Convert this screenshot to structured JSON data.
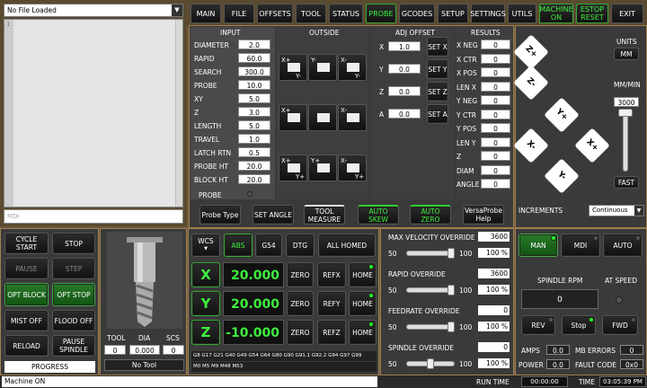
{
  "file": {
    "name": "No File Loaded",
    "line": "1",
    "mdi_placeholder": "MDI"
  },
  "tabs": [
    "MAIN",
    "FILE",
    "OFFSETS",
    "TOOL",
    "STATUS",
    "PROBE",
    "GCODES",
    "SETUP",
    "SETTINGS",
    "UTILS",
    "MACHINE ON",
    "ESTOP RESET",
    "EXIT"
  ],
  "probe": {
    "input_title": "INPUT",
    "outside_title": "OUTSIDE",
    "adj_title": "ADJ OFFSET",
    "results_title": "RESULTS",
    "inputs": [
      {
        "label": "DIAMETER",
        "value": "2.0"
      },
      {
        "label": "RAPID",
        "value": "60.0"
      },
      {
        "label": "SEARCH",
        "value": "300.0"
      },
      {
        "label": "PROBE",
        "value": "10.0"
      },
      {
        "label": "XY",
        "value": "5.0"
      },
      {
        "label": "Z",
        "value": "3.0"
      },
      {
        "label": "LENGTH",
        "value": "5.0"
      },
      {
        "label": "TRAVEL",
        "value": "1.0"
      },
      {
        "label": "LATCH RTN",
        "value": "0.5"
      },
      {
        "label": "PROBE HT",
        "value": "20.0"
      },
      {
        "label": "BLOCK HT",
        "value": "20.0"
      }
    ],
    "probe_label": "PROBE",
    "adj": [
      {
        "label": "X",
        "value": "1.0",
        "btn": "SET X"
      },
      {
        "label": "Y",
        "value": "0.0",
        "btn": "SET Y"
      },
      {
        "label": "Z",
        "value": "0.0",
        "btn": "SET Z"
      },
      {
        "label": "A",
        "value": "0.0",
        "btn": "SET A"
      }
    ],
    "results": [
      {
        "label": "X NEG",
        "value": "0"
      },
      {
        "label": "X CTR",
        "value": "0"
      },
      {
        "label": "X POS",
        "value": "0"
      },
      {
        "label": "LEN X",
        "value": "0"
      },
      {
        "label": "Y NEG",
        "value": "0"
      },
      {
        "label": "Y CTR",
        "value": "0"
      },
      {
        "label": "Y POS",
        "value": "0"
      },
      {
        "label": "LEN Y",
        "value": "0"
      },
      {
        "label": "Z",
        "value": "0"
      },
      {
        "label": "DIAM",
        "value": "0"
      },
      {
        "label": "ANGLE",
        "value": "0"
      }
    ],
    "buttons": [
      "Probe Type",
      "SET ANGLE",
      "TOOL MEASURE",
      "AUTO SKEW",
      "AUTO ZERO",
      "VersaProbe Help"
    ],
    "outside_labels": {
      "xp": "X+",
      "xm": "X-",
      "yp": "Y+",
      "ym": "Y-"
    }
  },
  "jog": {
    "z_plus": "Z+",
    "z_minus": "Z-",
    "y_plus": "Y+",
    "y_minus": "Y-",
    "x_plus": "X+",
    "x_minus": "X-",
    "units_label": "UNITS",
    "units": "MM",
    "rate_label": "MM/MIN",
    "rate": "3000",
    "fast": "FAST",
    "increments_label": "INCREMENTS",
    "increments": "Continuous"
  },
  "left": {
    "cycle_start": "CYCLE START",
    "stop": "STOP",
    "pause": "PAUSE",
    "step": "STEP",
    "opt_block": "OPT BLOCK",
    "opt_stop": "OPT STOP",
    "mist": "MIST OFF",
    "flood": "FLOOD OFF",
    "reload": "RELOAD",
    "pause_spindle": "PAUSE SPINDLE",
    "progress": "PROGRESS"
  },
  "tool": {
    "tool_label": "TOOL",
    "dia_label": "DIA",
    "scs_label": "SCS",
    "tool": "0",
    "dia": "0.000",
    "scs": "0",
    "name": "No Tool"
  },
  "dro": {
    "wcs": "WCS",
    "abs": "ABS",
    "g54": "G54",
    "dtg": "DTG",
    "homed": "ALL HOMED",
    "axes": [
      {
        "axis": "X",
        "value": "20.000",
        "zero": "ZERO",
        "ref": "REFX",
        "home": "HOME"
      },
      {
        "axis": "Y",
        "value": "20.000",
        "zero": "ZERO",
        "ref": "REFY",
        "home": "HOME"
      },
      {
        "axis": "Z",
        "value": "-10.000",
        "zero": "ZERO",
        "ref": "REFZ",
        "home": "HOME"
      }
    ],
    "gcodes": "G8 G17 G21 G40 G49 G54 G64 G80 G90 G91.1 G92.2 G94 G97 G99",
    "mcodes": "M0 M5 M9 M48 M53"
  },
  "overrides": [
    {
      "label": "MAX VELOCITY OVERRIDE",
      "value": "3600",
      "min": "50",
      "max": "100",
      "pct": "100 %",
      "level": 1.0
    },
    {
      "label": "RAPID OVERRIDE",
      "value": "3600",
      "min": "50",
      "max": "100",
      "pct": "100 %",
      "level": 1.0
    },
    {
      "label": "FEEDRATE OVERRIDE",
      "value": "0",
      "min": "50",
      "max": "100",
      "pct": "100 %",
      "level": 1.0
    },
    {
      "label": "SPINDLE OVERRIDE",
      "value": "0",
      "min": "50",
      "max": "100",
      "pct": "100 %",
      "level": 0.5
    }
  ],
  "spindle": {
    "man": "MAN",
    "mdi": "MDI",
    "auto": "AUTO",
    "rpm_label": "SPINDLE RPM",
    "rpm": "0",
    "at_speed": "AT SPEED",
    "rev": "REV",
    "stop": "Stop",
    "fwd": "FWD",
    "amps_label": "AMPS",
    "amps": "0.0",
    "mb_label": "MB ERRORS",
    "mb": "0",
    "power_label": "POWER",
    "power": "0.0",
    "fault_label": "FAULT CODE",
    "fault": "0x0"
  },
  "status": {
    "message": "Machine ON",
    "run_time_label": "RUN TIME",
    "run_time": "00:00:00",
    "time_label": "TIME",
    "time": "03:05:39 PM"
  }
}
